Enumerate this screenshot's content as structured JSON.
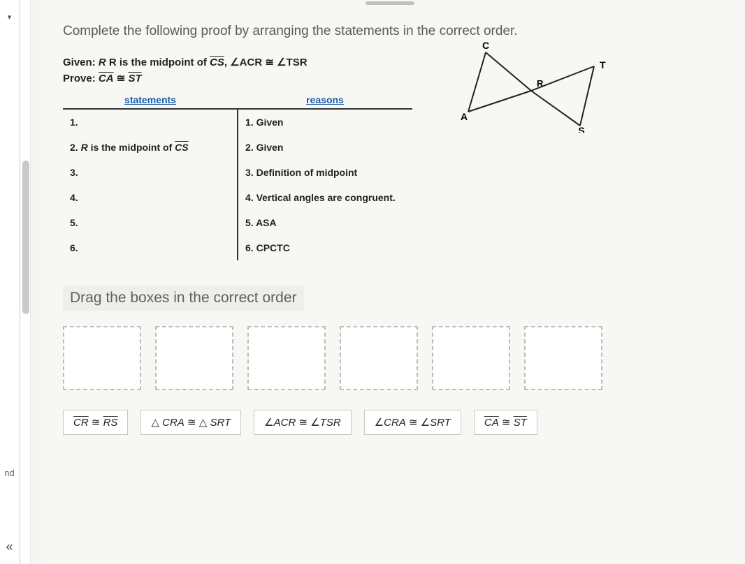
{
  "left_panel": {
    "nd_text": "nd",
    "chevron": "«",
    "caret": "▾"
  },
  "instruction": "Complete the following proof by arranging the statements in the correct order.",
  "given": {
    "label": "Given:",
    "text_prefix": "R is the midpoint of ",
    "seg": "CS",
    "angle_lhs": "∠ACR",
    "cong": "≅",
    "angle_rhs": "∠TSR"
  },
  "prove": {
    "label": "Prove:",
    "seg_lhs": "CA",
    "cong": "≅",
    "seg_rhs": "ST"
  },
  "headers": {
    "statements": "statements",
    "reasons": "reasons"
  },
  "rows": [
    {
      "n": "1.",
      "statement": "",
      "reason": "Given"
    },
    {
      "n": "2.",
      "statement": "R is the midpoint of CS",
      "statement_seg": "CS",
      "reason": "Given"
    },
    {
      "n": "3.",
      "statement": "",
      "reason": "Definition of midpoint"
    },
    {
      "n": "4.",
      "statement": "",
      "reason": "Vertical angles are congruent."
    },
    {
      "n": "5.",
      "statement": "",
      "reason": "ASA"
    },
    {
      "n": "6.",
      "statement": "",
      "reason": "CPCTC"
    }
  ],
  "figure_labels": {
    "C": "C",
    "A": "A",
    "R": "R",
    "T": "T",
    "S": "S"
  },
  "drag_title": "Drag the boxes in the correct order",
  "slots": 6,
  "tiles": [
    {
      "type": "seg_cong",
      "lhs": "CR",
      "rhs": "RS"
    },
    {
      "type": "tri_cong",
      "lhs": "CRA",
      "rhs": "SRT"
    },
    {
      "type": "ang_cong",
      "lhs": "ACR",
      "rhs": "TSR"
    },
    {
      "type": "ang_cong",
      "lhs": "CRA",
      "rhs": "SRT"
    },
    {
      "type": "seg_cong",
      "lhs": "CA",
      "rhs": "ST"
    }
  ]
}
